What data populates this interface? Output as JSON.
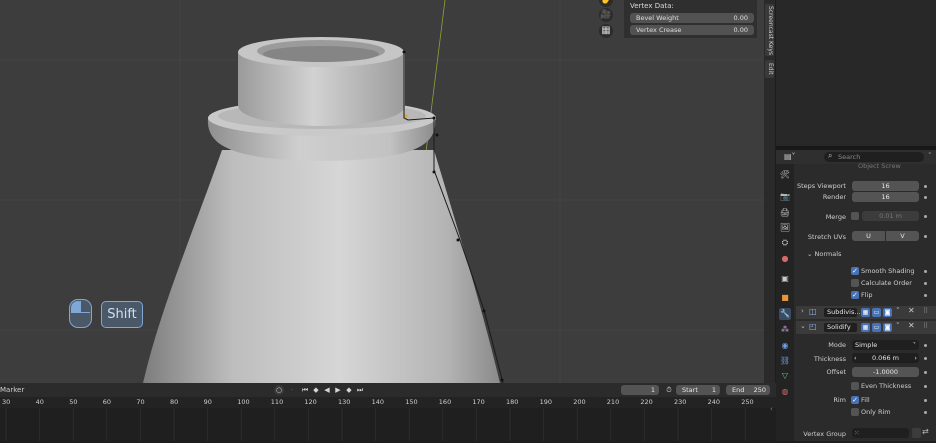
{
  "viewport": {
    "key_label": "Shift",
    "mouse_icon": "mouse-left-click-icon",
    "tools": [
      "hand-pan-icon",
      "camera-icon",
      "grid-icon"
    ]
  },
  "vertex_data": {
    "title": "Vertex Data:",
    "rows": [
      {
        "label": "Bevel Weight",
        "value": "0.00"
      },
      {
        "label": "Vertex Crease",
        "value": "0.00"
      }
    ]
  },
  "side_tabs": [
    "Screencast Keys",
    "Edit"
  ],
  "properties": {
    "search_placeholder": "Search",
    "cut_text": "Object Screw",
    "steps_viewport_label": "Steps Viewport",
    "steps_viewport_value": "16",
    "render_label": "Render",
    "render_value": "16",
    "merge_label": "Merge",
    "merge_value": "0.01 m",
    "stretch_label": "Stretch UVs",
    "stretch_u": "U",
    "stretch_v": "V",
    "normals_label": "Normals",
    "smooth_shading": "Smooth Shading",
    "calculate_order": "Calculate Order",
    "flip": "Flip",
    "modifiers": [
      {
        "name": "Subdivis...",
        "collapsed": true
      },
      {
        "name": "Solidify",
        "collapsed": false
      }
    ],
    "mode_label": "Mode",
    "mode_value": "Simple",
    "thickness_label": "Thickness",
    "thickness_value": "0.066 m",
    "offset_label": "Offset",
    "offset_value": "-1.0000",
    "even_thickness": "Even Thickness",
    "rim_label": "Rim",
    "rim_fill": "Fill",
    "only_rim": "Only Rim",
    "vertex_group_label": "Vertex Group"
  },
  "timeline": {
    "marker_label": "Marker",
    "current_frame": "1",
    "start_label": "Start",
    "start_value": "1",
    "end_label": "End",
    "end_value": "250",
    "ticks": [
      "30",
      "40",
      "50",
      "60",
      "70",
      "80",
      "90",
      "100",
      "110",
      "120",
      "130",
      "140",
      "150",
      "160",
      "170",
      "180",
      "190",
      "200",
      "210",
      "220",
      "230",
      "240",
      "250"
    ]
  }
}
